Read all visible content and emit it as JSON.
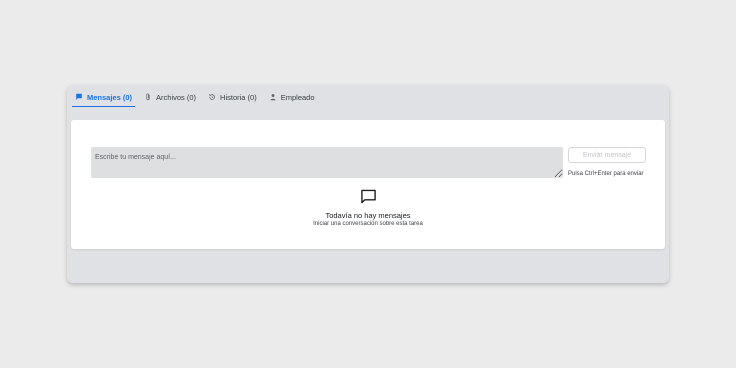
{
  "tabs": [
    {
      "label": "Mensajes (0)",
      "icon": "flag-icon",
      "active": true
    },
    {
      "label": "Archivos (0)",
      "icon": "paperclip-icon",
      "active": false
    },
    {
      "label": "Historia (0)",
      "icon": "history-icon",
      "active": false
    },
    {
      "label": "Empleado",
      "icon": "person-icon",
      "active": false
    }
  ],
  "composer": {
    "placeholder": "Escribe tu mensaje aquí...",
    "value": ""
  },
  "send_button": {
    "label": "Enviar mensaje",
    "disabled": true
  },
  "hint": "Pulsa Ctrl+Enter para enviar",
  "empty_state": {
    "icon": "chat-bubble-icon",
    "title": "Todavía no hay mensajes",
    "subtitle": "Iniciar una conversación sobre esta tarea"
  },
  "colors": {
    "accent": "#1a73e8",
    "panel_bg": "#dfe1e4",
    "card_bg": "#ffffff",
    "input_bg": "#dedfe1"
  }
}
